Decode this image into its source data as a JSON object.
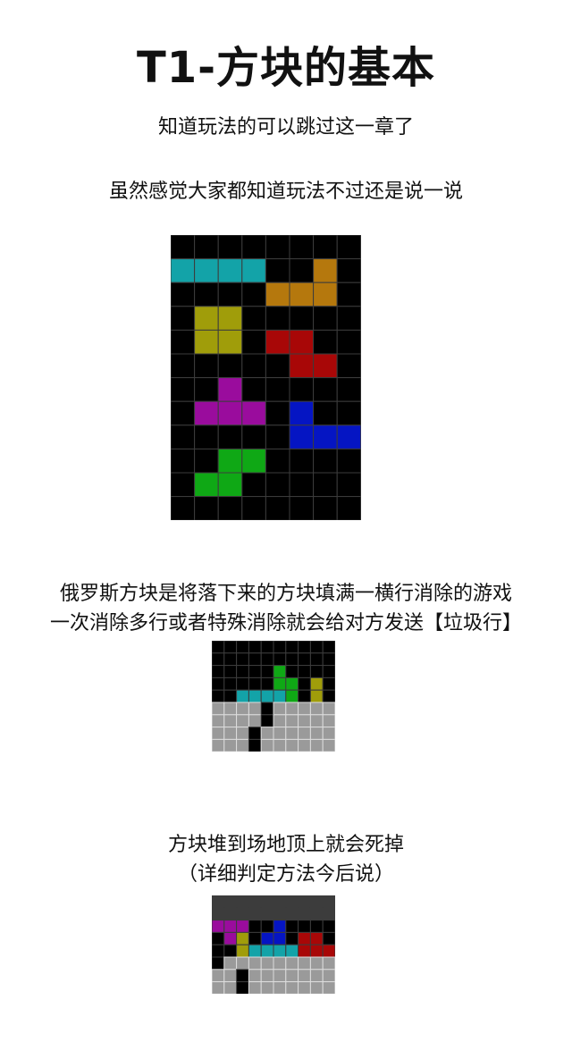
{
  "title": "T1-方块的基本",
  "intro": {
    "skip_note": "知道玩法的可以跳过这一章了",
    "preface": "虽然感觉大家都知道玩法不过还是说一说"
  },
  "clear_section": {
    "line1": "俄罗斯方块是将落下来的方块填满一横行消除的游戏",
    "line2": "一次消除多行或者特殊消除就会给对方发送【垃圾行】"
  },
  "death_section": {
    "line1": "方块堆到场地顶上就会死掉",
    "line2": "（详细判定方法今后说）"
  },
  "colors": {
    "I": "#13a3a8",
    "L": "#b5780d",
    "O": "#a09d0a",
    "Z": "#a80707",
    "T": "#9a0c9d",
    "J": "#0515c3",
    "S": "#0fa815",
    "G": "#9a9a9a",
    "empty": "#000000",
    "grid_dark": "#3c3c3c",
    "grid_light": "#dcdcdc",
    "danger": "#3c3c3c"
  },
  "boards": [
    {
      "id": "pieces",
      "rows": [
        "........",
        "IIII..L.",
        "....LLL.",
        ".OO.....",
        ".OO.ZZ..",
        ".....ZZ.",
        "..T.....",
        ".TTT.J..",
        ".....JJJ",
        "..SS....",
        ".SS.....",
        "........"
      ]
    },
    {
      "id": "garbage",
      "rows": [
        "..........",
        "..........",
        ".....S....",
        ".....SS.O.",
        "..IIIIS.O.",
        "GGGG.GGGGG",
        "GGGG.GGGGG",
        "GGG.GGGGGG",
        "GGG.GGGGGG"
      ]
    },
    {
      "id": "topout",
      "rows": [
        "XXXXXXXXXX",
        "XXXXXXXXXX",
        "TTT..J....",
        ".TO.JJ.ZZ.",
        "..OIIIIZZZ",
        ".GGGGGGGGG",
        "GG.GGGGGGG",
        "GG.GGGGGGG"
      ]
    }
  ]
}
